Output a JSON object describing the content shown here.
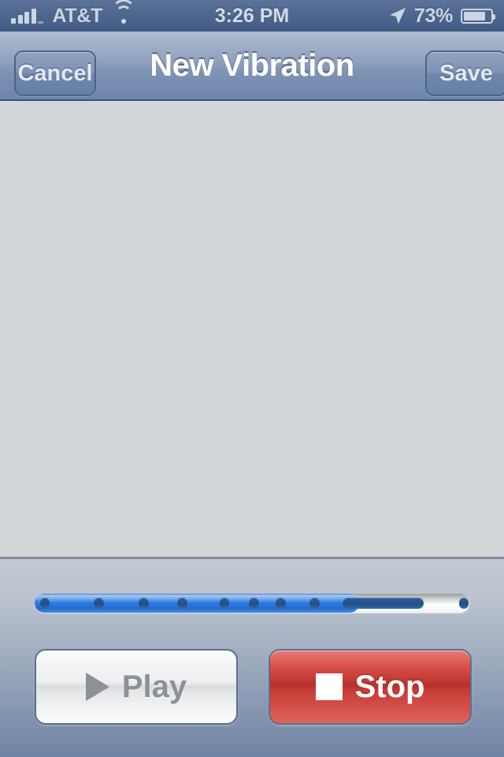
{
  "status_bar": {
    "carrier": "AT&T",
    "signal_bars_filled": 4,
    "signal_bars_total": 5,
    "wifi_icon": "wifi-icon",
    "time": "3:26 PM",
    "location_icon": "location-arrow-icon",
    "battery_percent": "73%",
    "battery_level": 73,
    "battery_icon": "battery-icon",
    "text_color": "#ccd5e2",
    "background_color": "#4e678f"
  },
  "nav_bar": {
    "title": "New Vibration",
    "cancel_label": "Cancel",
    "save_label": "Save",
    "title_color": "#ffffff",
    "button_color": "#e3e9f2"
  },
  "content": {
    "background_color": "#d3d7da"
  },
  "bottom_panel": {
    "track": {
      "name": "vibration-pattern-scrubber",
      "fill_percent": 74.6,
      "fill_color": "#2e7ae0",
      "empty_color": "#ffffff",
      "mark_color": "#2c5d9e",
      "marks": [
        {
          "left_pct": 1.6,
          "width_pct": 3.1
        },
        {
          "left_pct": 18.3,
          "width_pct": 3.1
        },
        {
          "left_pct": 32.1,
          "width_pct": 3.1
        },
        {
          "left_pct": 44.0,
          "width_pct": 3.1
        },
        {
          "left_pct": 57.0,
          "width_pct": 3.1
        },
        {
          "left_pct": 66.1,
          "width_pct": 3.1
        },
        {
          "left_pct": 74.3,
          "width_pct": 3.1
        },
        {
          "left_pct": 84.8,
          "width_pct": 3.1
        },
        {
          "left_pct": 94.9,
          "width_pct": 25.0
        },
        {
          "left_pct": 130.8,
          "width_pct": 3.1
        },
        {
          "left_pct": 155.1,
          "width_pct": 3.1
        },
        {
          "left_pct": 158.9,
          "width_pct": 3.1
        },
        {
          "left_pct": 162.7,
          "width_pct": 3.1
        },
        {
          "left_pct": 166.5,
          "width_pct": 3.1
        },
        {
          "left_pct": 170.3,
          "width_pct": 3.1
        },
        {
          "left_pct": 174.1,
          "width_pct": 3.1
        }
      ]
    },
    "play_label": "Play",
    "play_icon": "play-triangle-icon",
    "play_enabled": false,
    "stop_label": "Stop",
    "stop_icon": "stop-square-icon",
    "stop_enabled": true,
    "stop_color": "#c53c36"
  }
}
